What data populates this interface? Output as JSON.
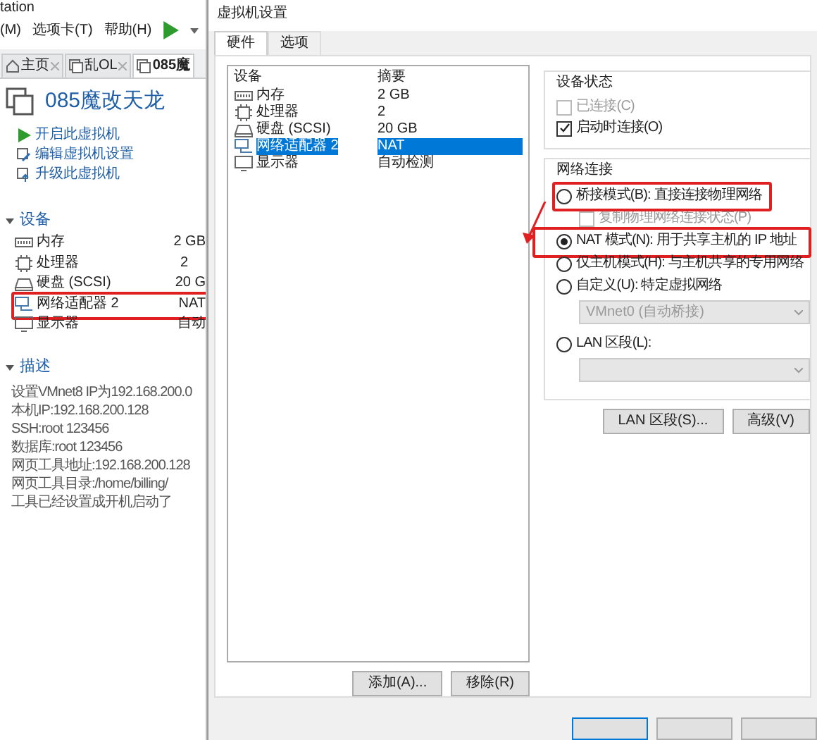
{
  "background_app": {
    "title": "tation",
    "menu": [
      "(M)",
      "选项卡(T)",
      "帮助(H)"
    ],
    "tabs": [
      {
        "label": "主页",
        "kind": "home",
        "selected": false
      },
      {
        "label": "乱OL",
        "kind": "vm",
        "selected": false
      },
      {
        "label": "085魔",
        "kind": "vm",
        "selected": true
      }
    ],
    "vm_name": "085魔改天龙",
    "actions": [
      {
        "label": "开启此虚拟机",
        "kind": "play"
      },
      {
        "label": "编辑虚拟机设置",
        "kind": "edit"
      },
      {
        "label": "升级此虚拟机",
        "kind": "upgrade"
      }
    ],
    "devices_heading": "设备",
    "devices": [
      {
        "name": "内存",
        "value": "2 GB",
        "kind": "memory"
      },
      {
        "name": "处理器",
        "value": "2",
        "kind": "cpu"
      },
      {
        "name": "硬盘 (SCSI)",
        "value": "20 G",
        "kind": "disk"
      },
      {
        "name": "网络适配器 2",
        "value": "NAT",
        "kind": "network"
      },
      {
        "name": "显示器",
        "value": "自动",
        "kind": "display"
      }
    ],
    "description_heading": "描述",
    "description": [
      "设置VMnet8 IP为192.168.200.0",
      "本机IP:192.168.200.128",
      "SSH:root 123456",
      "数据库:root 123456",
      "网页工具地址:192.168.200.128",
      "网页工具目录:/home/billing/",
      "工具已经设置成开机启动了"
    ]
  },
  "dialog": {
    "title": "虚拟机设置",
    "tabs": [
      {
        "label": "硬件",
        "selected": true
      },
      {
        "label": "选项",
        "selected": false
      }
    ],
    "columns": [
      "设备",
      "摘要"
    ],
    "rows": [
      {
        "device": "内存",
        "summary": "2 GB",
        "kind": "memory",
        "selected": false
      },
      {
        "device": "处理器",
        "summary": "2",
        "kind": "cpu",
        "selected": false
      },
      {
        "device": "硬盘 (SCSI)",
        "summary": "20 GB",
        "kind": "disk",
        "selected": false
      },
      {
        "device": "网络适配器 2",
        "summary": "NAT",
        "kind": "network",
        "selected": true
      },
      {
        "device": "显示器",
        "summary": "自动检测",
        "kind": "display",
        "selected": false
      }
    ],
    "list_buttons": [
      "添加(A)...",
      "移除(R)"
    ],
    "device_status": {
      "title": "设备状态",
      "options": [
        {
          "label": "已连接(C)",
          "checked": false,
          "disabled": true
        },
        {
          "label": "启动时连接(O)",
          "checked": true,
          "disabled": false
        }
      ]
    },
    "network": {
      "title": "网络连接",
      "options": [
        {
          "kind": "radio",
          "label": "桥接模式(B): 直接连接物理网络",
          "selected": false
        },
        {
          "kind": "checkbox",
          "label": "复制物理网络连接状态(P)",
          "checked": false,
          "disabled": true
        },
        {
          "kind": "radio",
          "label": "NAT 模式(N): 用于共享主机的 IP 地址",
          "selected": true
        },
        {
          "kind": "radio",
          "label": "仅主机模式(H): 与主机共享的专用网络",
          "selected": false
        },
        {
          "kind": "radio",
          "label": "自定义(U): 特定虚拟网络",
          "selected": false
        },
        {
          "kind": "dropdown",
          "value": "VMnet0 (自动桥接)",
          "disabled": true
        },
        {
          "kind": "radio",
          "label": "LAN 区段(L):",
          "selected": false
        },
        {
          "kind": "dropdown",
          "disabled": true
        }
      ]
    },
    "buttons": [
      "LAN 区段(S)...",
      "高级(V)"
    ]
  }
}
